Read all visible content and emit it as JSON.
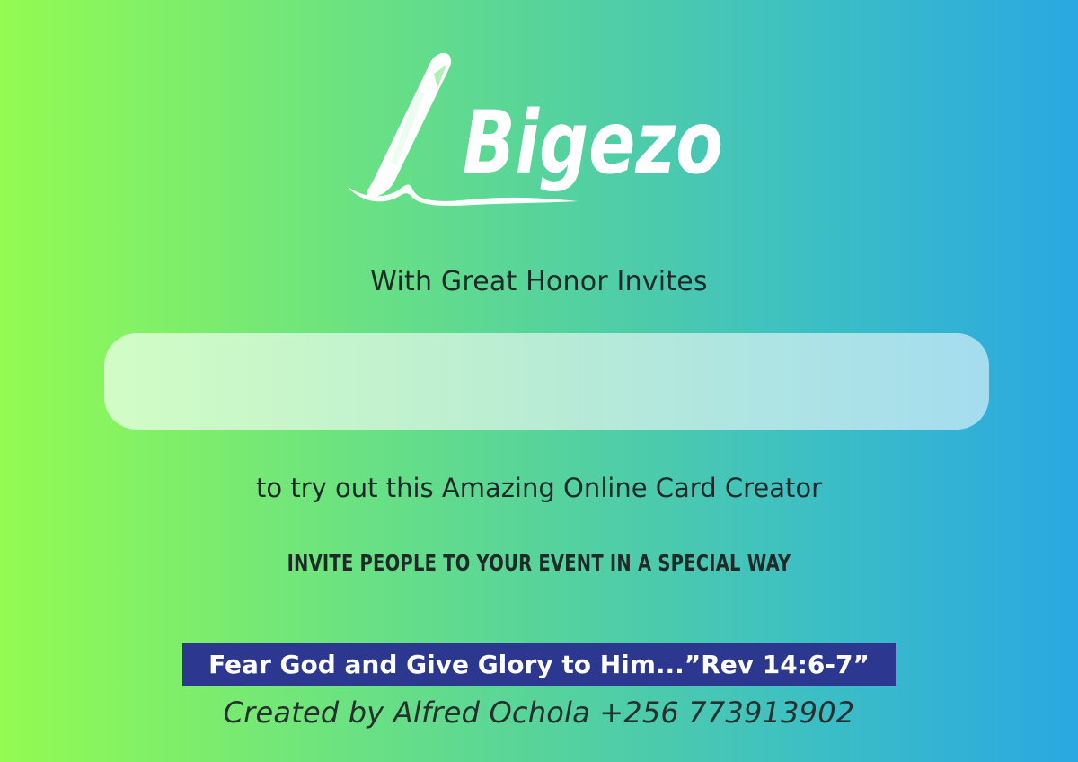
{
  "logo": {
    "brand_name": "Bigezo",
    "icon": "pen-icon",
    "color": "#ffffff"
  },
  "invite": {
    "subtitle": "With Great Honor Invites",
    "name_value": "",
    "tagline": "to try out this Amazing Online Card Creator",
    "headline": "INVITE PEOPLE TO YOUR EVENT IN A SPECIAL WAY"
  },
  "verse": {
    "text": "Fear God and Give Glory to Him...”Rev 14:6-7”",
    "background": "#2c378f"
  },
  "credit": {
    "text": "Created by Alfred Ochola +256 773913902"
  },
  "colors": {
    "gradient_start": "#93fb52",
    "gradient_end": "#29a8e2",
    "text": "#1e2a2a"
  }
}
